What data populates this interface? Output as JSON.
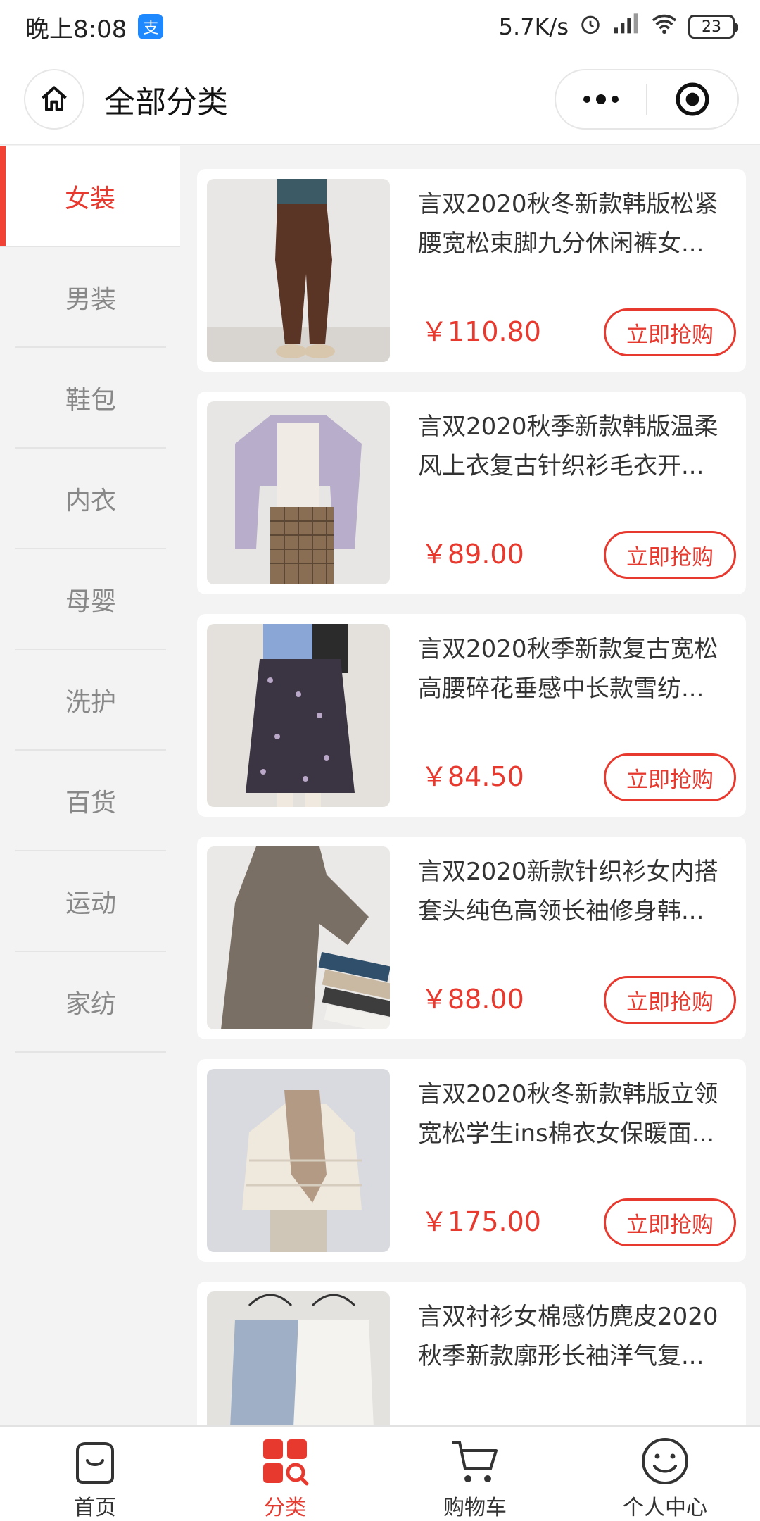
{
  "status": {
    "time": "晚上8:08",
    "app_icon_text": "支",
    "net_speed": "5.7K/s",
    "battery": "23"
  },
  "header": {
    "title": "全部分类"
  },
  "sidebar": {
    "items": [
      {
        "label": "女装"
      },
      {
        "label": "男装"
      },
      {
        "label": "鞋包"
      },
      {
        "label": "内衣"
      },
      {
        "label": "母婴"
      },
      {
        "label": "洗护"
      },
      {
        "label": "百货"
      },
      {
        "label": "运动"
      },
      {
        "label": "家纺"
      }
    ]
  },
  "products": [
    {
      "title": "言双2020秋冬新款韩版松紧腰宽松束脚九分休闲裤女...",
      "price": "￥110.80",
      "button": "立即抢购"
    },
    {
      "title": "言双2020秋季新款韩版温柔风上衣复古针织衫毛衣开...",
      "price": "￥89.00",
      "button": "立即抢购"
    },
    {
      "title": "言双2020秋季新款复古宽松高腰碎花垂感中长款雪纺...",
      "price": "￥84.50",
      "button": "立即抢购"
    },
    {
      "title": "言双2020新款针织衫女内搭套头纯色高领长袖修身韩...",
      "price": "￥88.00",
      "button": "立即抢购"
    },
    {
      "title": "言双2020秋冬新款韩版立领宽松学生ins棉衣女保暖面...",
      "price": "￥175.00",
      "button": "立即抢购"
    },
    {
      "title": "言双衬衫女棉感仿麂皮2020秋季新款廓形长袖洋气复...",
      "price": "",
      "button": ""
    }
  ],
  "tabbar": {
    "items": [
      {
        "label": "首页",
        "icon": "home-bag-icon"
      },
      {
        "label": "分类",
        "icon": "category-icon"
      },
      {
        "label": "购物车",
        "icon": "cart-icon"
      },
      {
        "label": "个人中心",
        "icon": "smile-icon"
      }
    ]
  },
  "colors": {
    "accent": "#e8392f"
  }
}
